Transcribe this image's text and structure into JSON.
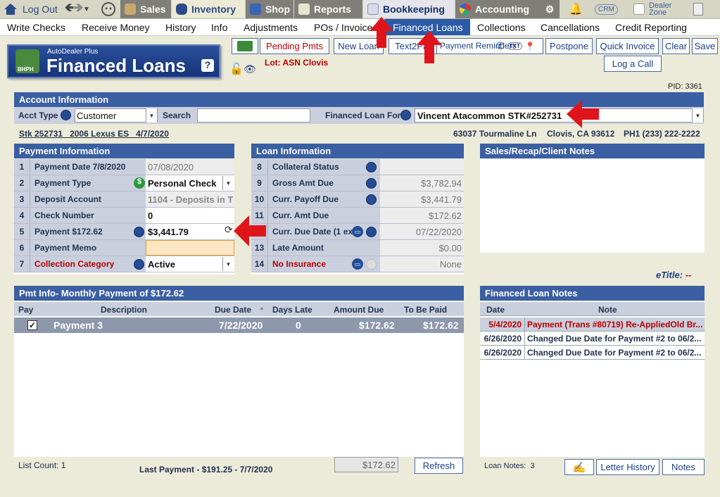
{
  "nav": {
    "logout": "Log Out",
    "items": [
      {
        "label": "Sales",
        "icon": "sales-person-icon"
      },
      {
        "label": "Inventory",
        "icon": "car-icon"
      },
      {
        "label": "Shop",
        "icon": "wrench-icon"
      },
      {
        "label": "Reports",
        "icon": "report-icon"
      },
      {
        "label": "Bookkeeping",
        "icon": "book-icon"
      },
      {
        "label": "Accounting",
        "icon": "pie-chart-icon"
      }
    ],
    "crm": "CRM",
    "dealer_zone": "Dealer Zone"
  },
  "subnav": [
    "Write Checks",
    "Receive Money",
    "History",
    "Info",
    "Adjustments",
    "POs / Invoices",
    "Financed Loans",
    "Collections",
    "Cancellations",
    "Credit Reporting"
  ],
  "app": {
    "brand": "AutoDealer Plus",
    "title": "Financed Loans",
    "help": "?",
    "badge": "BHPH",
    "lot": "Lot: ASN Clovis"
  },
  "toolbar": {
    "pending": "Pending Pmts",
    "new_loan": "New Loan",
    "text2pay": "Text2Pay",
    "payment_reminders": "Payment Reminders",
    "txt": "TXT",
    "postpone": "Postpone",
    "quick_invoice": "Quick Invoice",
    "clear": "Clear",
    "save": "Save",
    "log_call": "Log a Call"
  },
  "pid": "PID: 3361",
  "account": {
    "header": "Account Information",
    "acct_type_label": "Acct Type",
    "acct_type": "Customer",
    "search_label": "Search",
    "search_value": "",
    "for_label": "Financed Loan For",
    "for_value": "Vincent Atacommon STK#252731",
    "stk": "Stk 252731",
    "vehicle": "2006 Lexus ES",
    "date": "4/7/2020",
    "address": "63037 Tourmaline Ln",
    "city": "Clovis, CA 93612",
    "phone": "PH1 (233) 222-2222"
  },
  "payment": {
    "header": "Payment Information",
    "rows": [
      {
        "n": "1",
        "label": "Payment Date  7/8/2020",
        "value": "07/08/2020"
      },
      {
        "n": "2",
        "label": "Payment Type",
        "value": "Personal Check"
      },
      {
        "n": "3",
        "label": "Deposit Account",
        "value": "1104 - Deposits in T"
      },
      {
        "n": "4",
        "label": "Check Number",
        "value": "0"
      },
      {
        "n": "5",
        "label": "Payment  $172.62",
        "value": "$3,441.79"
      },
      {
        "n": "6",
        "label": "Payment Memo",
        "value": ""
      },
      {
        "n": "7",
        "label": "Collection Category",
        "value": "Active"
      }
    ]
  },
  "loan": {
    "header": "Loan Information",
    "rows": [
      {
        "n": "8",
        "label": "Collateral Status",
        "value": ""
      },
      {
        "n": "9",
        "label": "Gross Amt Due",
        "value": "$3,782.94"
      },
      {
        "n": "10",
        "label": "Curr. Payoff Due",
        "value": "$3,441.79"
      },
      {
        "n": "11",
        "label": "Curr. Amt Due",
        "value": "$172.62"
      },
      {
        "n": "12",
        "label": "Curr. Due Date (1 ex",
        "value": "07/22/2020"
      },
      {
        "n": "13",
        "label": "Late Amount",
        "value": "$0.00"
      },
      {
        "n": "14",
        "label": "No Insurance",
        "value": "None"
      }
    ]
  },
  "notes_panel": {
    "header": "Sales/Recap/Client Notes"
  },
  "etitle": {
    "label": "eTitle:",
    "value": "--"
  },
  "pmt": {
    "header": "Pmt Info- Monthly Payment of $172.62",
    "columns": [
      "Pay",
      "Description",
      "Due Date",
      "Days Late",
      "Amount Due",
      "To Be Paid"
    ],
    "rows": [
      {
        "desc": "Payment 3",
        "due": "7/22/2020",
        "late": "0",
        "amount": "$172.62",
        "paid": "$172.62"
      }
    ],
    "list_count_label": "List Count:",
    "list_count": "1",
    "last_payment": "Last Payment - $191.25 - 7/7/2020",
    "total": "$172.62",
    "refresh": "Refresh"
  },
  "loan_notes": {
    "header": "Financed Loan Notes",
    "columns": [
      "Date",
      "Note"
    ],
    "rows": [
      {
        "date": "5/4/2020",
        "note": "Payment (Trans #80719) Re-AppliedOld Br..."
      },
      {
        "date": "6/26/2020",
        "note": "Changed Due Date for Payment #2 to 06/2..."
      },
      {
        "date": "6/26/2020",
        "note": "Changed Due Date for Payment #2 to 06/2..."
      }
    ],
    "count_label": "Loan Notes:",
    "count": "3",
    "letter_history": "Letter History",
    "notes": "Notes"
  },
  "colors": {
    "accent": "#3b5fa3",
    "alert": "#cc0000",
    "arrow": "#e0141b"
  }
}
